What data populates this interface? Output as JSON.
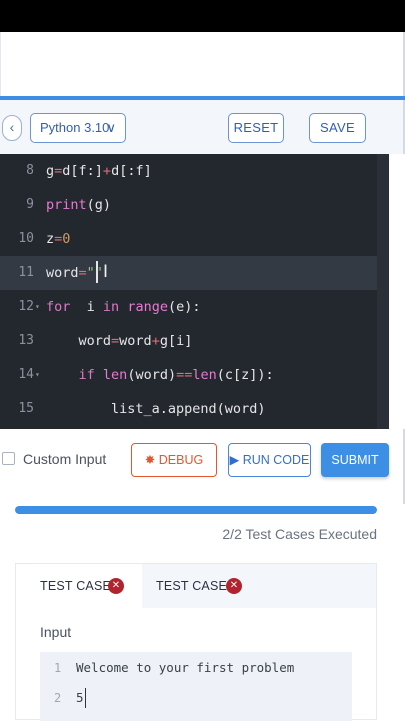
{
  "toolbar": {
    "back_icon": "chevron-left-icon",
    "language": "Python 3.10",
    "reset_label": "RESET",
    "save_label": "SAVE"
  },
  "editor": {
    "active_line": 11,
    "lines": [
      {
        "number": "8",
        "text": "g=d[f:]+d[:f]"
      },
      {
        "number": "9",
        "text": "print(g)"
      },
      {
        "number": "10",
        "text": "z=0"
      },
      {
        "number": "11",
        "text": "word=\"\""
      },
      {
        "number": "12",
        "text": "for  i in range(e):"
      },
      {
        "number": "13",
        "text": "    word=word+g[i]"
      },
      {
        "number": "14",
        "text": "    if len(word)==len(c[z]):"
      },
      {
        "number": "15",
        "text": "        list_a.append(word)"
      }
    ]
  },
  "actions": {
    "custom_input_label": "Custom Input",
    "debug_label": "DEBUG",
    "run_label": "RUN CODE",
    "submit_label": "SUBMIT"
  },
  "progress": {
    "fraction": 1.0,
    "executed_text": "2/2 Test Cases Executed"
  },
  "test_cases": {
    "tabs": [
      {
        "label": "TEST CASE 1",
        "badge": "✕"
      },
      {
        "label": "TEST CASE 2",
        "badge": "✕"
      }
    ],
    "input_label": "Input",
    "input_lines": [
      {
        "number": "1",
        "text": "Welcome to your first problem"
      },
      {
        "number": "2",
        "text": "5"
      }
    ]
  },
  "colors": {
    "accent": "#3d8fe6",
    "debug": "#e4572e",
    "error_badge": "#b3232d",
    "editor_bg": "#23272e"
  }
}
